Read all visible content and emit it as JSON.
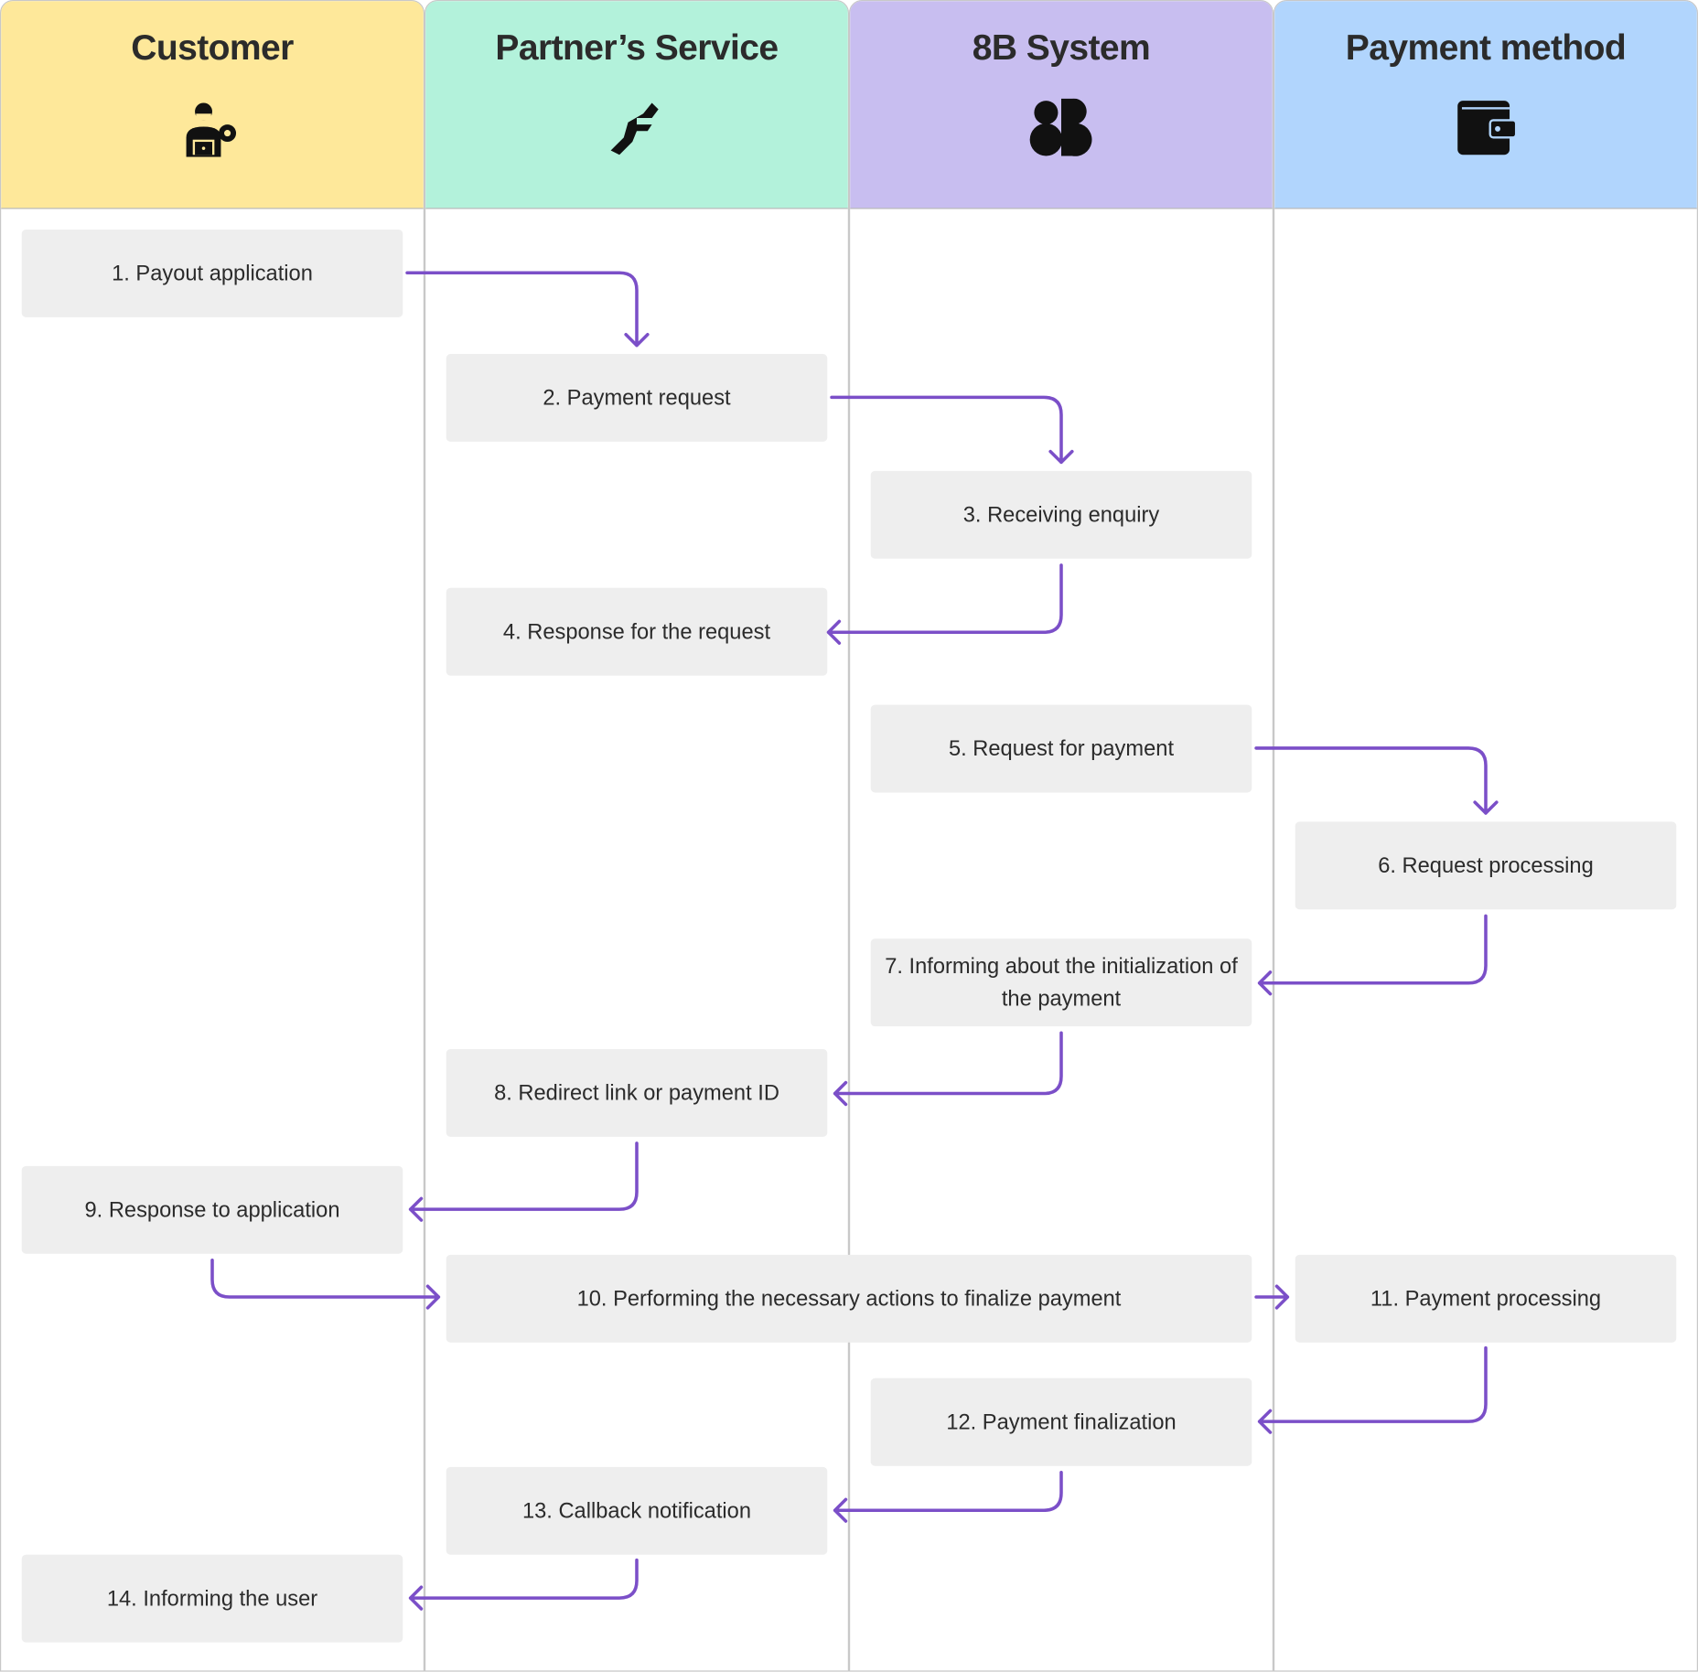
{
  "accent_color": "#7B4FC8",
  "lanes": [
    {
      "title": "Customer",
      "icon": "customer-laptop-gear-icon",
      "color": "#FEE89A"
    },
    {
      "title": "Partner’s Service",
      "icon": "handshake-icon",
      "color": "#B3F2DB"
    },
    {
      "title": "8B System",
      "icon": "8b-logo-icon",
      "color": "#C8BEF0"
    },
    {
      "title": "Payment method",
      "icon": "wallet-icon",
      "color": "#B1D5FD"
    }
  ],
  "steps": [
    "1. Payout application",
    "2. Payment request",
    "3. Receiving enquiry",
    "4. Response for the request",
    "5. Request for payment",
    "6. Request processing",
    "7. Informing about the initialization of the payment",
    "8. Redirect link or payment ID",
    "9. Response to application",
    "10. Performing the necessary actions to finalize payment",
    "11. Payment processing",
    "12. Payment finalization",
    "13. Callback notification",
    "14. Informing the user"
  ]
}
